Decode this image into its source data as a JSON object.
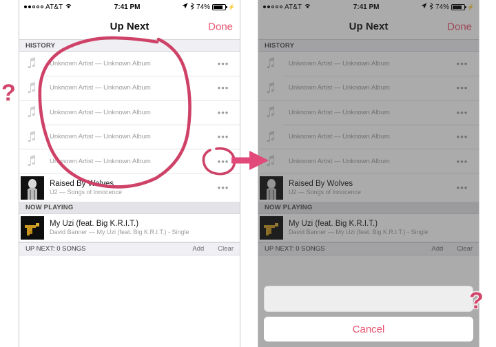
{
  "meta": {
    "accent_pink": "#e8506e",
    "annotation_pink": "#d2456a",
    "bg": "#ffffff"
  },
  "status_bar": {
    "carrier": "AT&T",
    "signal_dots_filled": 2,
    "signal_dots_total": 5,
    "wifi_icon": "wifi-icon",
    "time": "7:41 PM",
    "location_icon": "location-arrow-icon",
    "bluetooth_icon": "bluetooth-icon",
    "battery_percent": "74%",
    "battery_fill": 74,
    "charging_icon": "charging-bolt-icon"
  },
  "nav": {
    "title": "Up Next",
    "done_label": "Done"
  },
  "sections": {
    "history_label": "HISTORY",
    "now_playing_label": "NOW PLAYING"
  },
  "history_rows": [
    {
      "subtitle": "Unknown Artist — Unknown Album",
      "icon": "music-note-icon",
      "more": "•••"
    },
    {
      "subtitle": "Unknown Artist — Unknown Album",
      "icon": "music-note-icon",
      "more": "•••"
    },
    {
      "subtitle": "Unknown Artist — Unknown Album",
      "icon": "music-note-icon",
      "more": "•••"
    },
    {
      "subtitle": "Unknown Artist — Unknown Album",
      "icon": "music-note-icon",
      "more": "•••"
    },
    {
      "subtitle": "Unknown Artist — Unknown Album",
      "icon": "music-note-icon",
      "more": "•••"
    }
  ],
  "history_last_track": {
    "title": "Raised By Wolves",
    "subtitle": "U2 — Songs of Innocence",
    "more": "•••",
    "artwork": "album-art-songs-of-innocence"
  },
  "now_playing_track": {
    "title": "My Uzi (feat. Big K.R.I.T.)",
    "subtitle": "David Banner — My Uzi (feat. Big K.R.I.T.) - Single",
    "artwork": "album-art-my-uzi"
  },
  "up_next_bar": {
    "label": "UP NEXT: 0 SONGS",
    "add_label": "Add",
    "clear_label": "Clear"
  },
  "action_sheet": {
    "panel_label": "",
    "cancel_label": "Cancel"
  },
  "annotations": {
    "question_mark_left": "?",
    "question_mark_right": "?",
    "circle_note": "circle-around-history-rows",
    "circle_ellipsis_note": "circle-around-ellipsis-button",
    "arrow_note": "arrow-pointing-right"
  }
}
